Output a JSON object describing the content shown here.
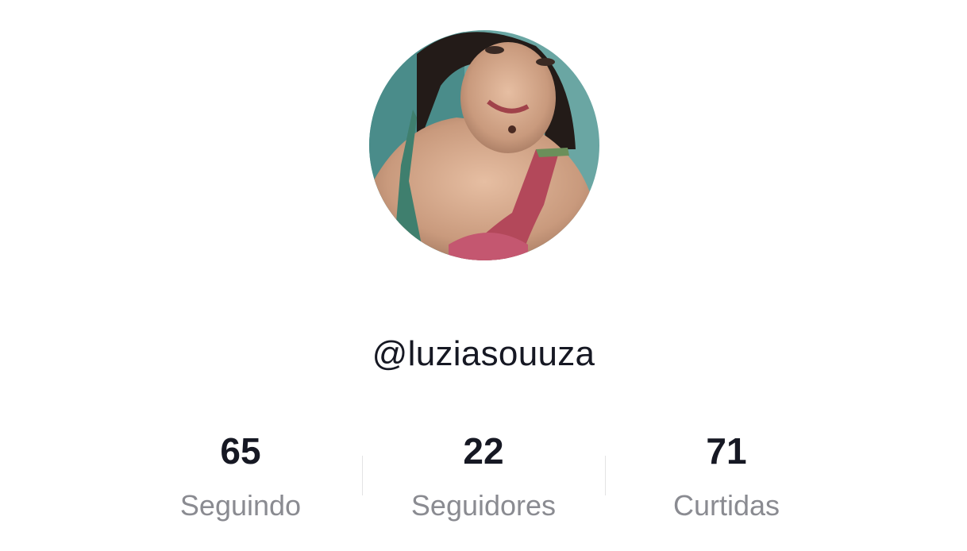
{
  "profile": {
    "username": "@luziasouuza",
    "avatar_icon": "profile-photo"
  },
  "stats": [
    {
      "value": "65",
      "label": "Seguindo"
    },
    {
      "value": "22",
      "label": "Seguidores"
    },
    {
      "value": "71",
      "label": "Curtidas"
    }
  ],
  "colors": {
    "text_primary": "#161823",
    "text_secondary": "#8a8b91",
    "divider": "#e3e3e4"
  }
}
